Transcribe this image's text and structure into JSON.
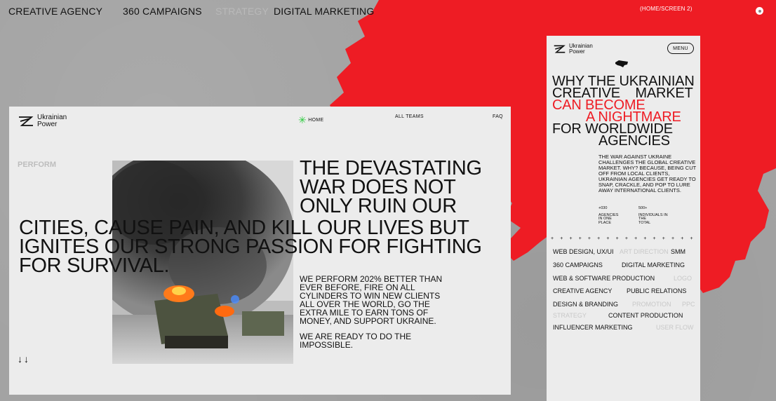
{
  "top_nav": {
    "items": [
      "CREATIVE AGENCY",
      "360 CAMPAIGNS",
      "STRATEGY",
      "DIGITAL MARKETING"
    ],
    "screen_label": "(HOME/SCREEN 2)"
  },
  "colors": {
    "accent_red": "#EE1C24",
    "background": "#A3A3A3",
    "card": "#ECECEC",
    "green_asterisk": "#2ECC40"
  },
  "desktop": {
    "logo": {
      "line1": "Ukrainian",
      "line2": "Power"
    },
    "nav": {
      "home": "HOME",
      "all_teams": "ALL TEAMS",
      "faq": "FAQ"
    },
    "perform_label": "PERFORM",
    "headline_right": [
      "THE DEVASTATING",
      "WAR DOES NOT",
      "ONLY RUIN OUR"
    ],
    "headline_full": [
      "CITIES, CAUSE PAIN, AND KILL OUR LIVES BUT",
      "IGNITES OUR STRONG PASSION FOR FIGHTING",
      "FOR SURVIVAL."
    ],
    "body1": "WE PERFORM 202% BETTER THAN\nEVER BEFORE, FIRE ON ALL\nCYLINDERS TO WIN NEW CLIENTS\nALL OVER THE WORLD, GO THE\nEXTRA MILE TO EARN TONS OF\nMONEY, AND SUPPORT UKRAINE.",
    "body2": "WE ARE READY TO DO THE\nIMPOSSIBLE.",
    "scroll_arrows": "↓↓"
  },
  "mobile": {
    "logo": {
      "line1": "Ukrainian",
      "line2": "Power"
    },
    "menu_label": "MENU",
    "headline": {
      "line1": "WHY THE UKRAINIAN",
      "line2": "CREATIVE    MARKET",
      "line3": "CAN BECOME",
      "line4": "A NIGHTMARE",
      "line5": "FOR WORLDWIDE",
      "line6": "AGENCIES"
    },
    "body": "THE WAR AGAINST UKRAINE CHALLENGES THE GLOBAL CREATIVE MARKET. WHY? BECAUSE, BEING CUT OFF FROM LOCAL CLIENTS, UKRAINIAN AGENCIES GET READY TO SNAP, CRACKLE, AND POP TO LURE AWAY INTERNATIONAL CLIENTS.",
    "stats": [
      {
        "value": "+030",
        "label": "AGENCIES\nIN ONE\nPLACE"
      },
      {
        "value": "500+",
        "label": "INDIVIDUALS IN\nTHE\nTOTAL"
      }
    ],
    "divider": "+ + + + + + + + + + + + + + + + + + + + + + +",
    "services": {
      "web_design": "WEB DESIGN, UX/UI",
      "art_direction": "ART DIRECTION",
      "smm": "SMM",
      "campaigns": "360 CAMPAIGNS",
      "digital_marketing": "DIGITAL MARKETING",
      "web_software": "WEB & SOFTWARE PRODUCTION",
      "logo": "LOGO",
      "creative_agency": "CREATIVE AGENCY",
      "public_relations": "PUBLIC RELATIONS",
      "design_branding": "DESIGN & BRANDING",
      "promotion": "PROMOTION",
      "ppc": "PPC",
      "strategy": "STRATEGY",
      "content_production": "CONTENT PRODUCTION",
      "influencer": "INFLUENCER MARKETING",
      "user_flow": "USER FLOW"
    }
  }
}
